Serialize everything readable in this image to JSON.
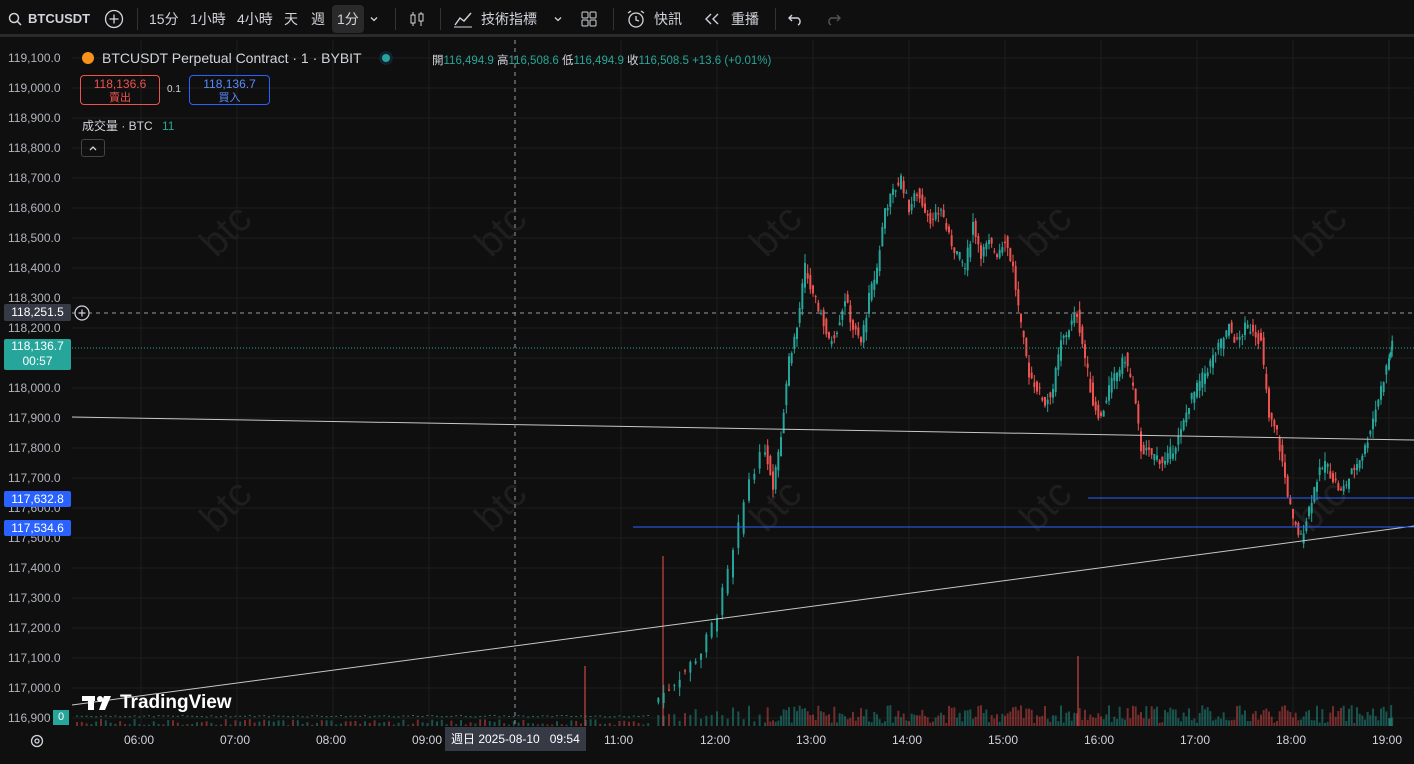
{
  "toolbar": {
    "symbol": "BTCUSDT",
    "timeframes": [
      "15分",
      "1小時",
      "4小時",
      "天",
      "週"
    ],
    "active_timeframe": "1分",
    "indicators_label": "技術指標",
    "alert_label": "快訊",
    "replay_label": "重播"
  },
  "legend": {
    "title": "BTCUSDT Perpetual Contract · 1 · BYBIT",
    "open_label": "開",
    "open": "116,494.9",
    "high_label": "高",
    "high": "116,508.6",
    "low_label": "低",
    "low": "116,494.9",
    "close_label": "收",
    "close": "116,508.5",
    "change": "+13.6 (+0.01%)",
    "sell_price": "118,136.6",
    "sell_label": "賣出",
    "spread": "0.1",
    "buy_price": "118,136.7",
    "buy_label": "買入",
    "volume_label": "成交量 · BTC",
    "volume_value": "11"
  },
  "price_axis": [
    "119,100.0",
    "119,000.0",
    "118,900.0",
    "118,800.0",
    "118,700.0",
    "118,600.0",
    "118,500.0",
    "118,400.0",
    "118,300.0",
    "118,200.0",
    "118,100.0",
    "118,000.0",
    "117,900.0",
    "117,800.0",
    "117,700.0",
    "117,600.0",
    "117,500.0",
    "117,400.0",
    "117,300.0",
    "117,200.0",
    "117,100.0",
    "117,000.0",
    "116,900"
  ],
  "time_axis": [
    "06:00",
    "07:00",
    "08:00",
    "09:00",
    "11:00",
    "12:00",
    "13:00",
    "14:00",
    "15:00",
    "16:00",
    "17:00",
    "18:00",
    "19:00"
  ],
  "crosshair": {
    "price": "118,251.5",
    "time": "週日 2025-08-10   09:54"
  },
  "last_price": {
    "price": "118,136.7",
    "countdown": "00:57"
  },
  "level_tags": [
    "117,632.8",
    "117,534.6"
  ],
  "volume_tag": "0",
  "watermark": "btc",
  "brand": "TradingView",
  "colors": {
    "up": "#26a69a",
    "down": "#ef5350",
    "order_line": "#2962ff",
    "bg": "#0f0f0f"
  },
  "chart_data": {
    "type": "candlestick",
    "ylim": [
      116900,
      119130
    ],
    "x_unit": "minutes since 05:00",
    "series_close": [
      [
        390,
        117000
      ],
      [
        400,
        117060
      ],
      [
        410,
        117120
      ],
      [
        420,
        117250
      ],
      [
        430,
        117450
      ],
      [
        440,
        117700
      ],
      [
        450,
        117800
      ],
      [
        455,
        117680
      ],
      [
        460,
        117850
      ],
      [
        465,
        118100
      ],
      [
        470,
        118200
      ],
      [
        475,
        118400
      ],
      [
        480,
        118300
      ],
      [
        485,
        118250
      ],
      [
        490,
        118150
      ],
      [
        495,
        118200
      ],
      [
        500,
        118300
      ],
      [
        505,
        118200
      ],
      [
        510,
        118150
      ],
      [
        515,
        118300
      ],
      [
        520,
        118400
      ],
      [
        525,
        118600
      ],
      [
        530,
        118650
      ],
      [
        535,
        118700
      ],
      [
        540,
        118600
      ],
      [
        545,
        118650
      ],
      [
        550,
        118600
      ],
      [
        555,
        118550
      ],
      [
        560,
        118600
      ],
      [
        565,
        118500
      ],
      [
        570,
        118450
      ],
      [
        575,
        118400
      ],
      [
        580,
        118550
      ],
      [
        585,
        118450
      ],
      [
        590,
        118480
      ],
      [
        595,
        118450
      ],
      [
        600,
        118500
      ],
      [
        605,
        118400
      ],
      [
        610,
        118200
      ],
      [
        615,
        118050
      ],
      [
        620,
        118000
      ],
      [
        625,
        117950
      ],
      [
        630,
        118000
      ],
      [
        635,
        118150
      ],
      [
        640,
        118200
      ],
      [
        645,
        118250
      ],
      [
        650,
        118100
      ],
      [
        655,
        117950
      ],
      [
        660,
        117900
      ],
      [
        665,
        118000
      ],
      [
        670,
        118050
      ],
      [
        675,
        118100
      ],
      [
        680,
        118000
      ],
      [
        685,
        117800
      ],
      [
        690,
        117780
      ],
      [
        695,
        117770
      ],
      [
        700,
        117750
      ],
      [
        705,
        117800
      ],
      [
        710,
        117850
      ],
      [
        715,
        117950
      ],
      [
        720,
        118000
      ],
      [
        725,
        118050
      ],
      [
        730,
        118100
      ],
      [
        735,
        118150
      ],
      [
        740,
        118200
      ],
      [
        745,
        118150
      ],
      [
        750,
        118200
      ],
      [
        755,
        118200
      ],
      [
        760,
        118150
      ],
      [
        765,
        117900
      ],
      [
        770,
        117850
      ],
      [
        775,
        117700
      ],
      [
        780,
        117550
      ],
      [
        785,
        117500
      ],
      [
        790,
        117600
      ],
      [
        795,
        117700
      ],
      [
        800,
        117750
      ],
      [
        805,
        117700
      ],
      [
        810,
        117650
      ],
      [
        815,
        117700
      ],
      [
        820,
        117750
      ],
      [
        825,
        117800
      ],
      [
        830,
        117900
      ],
      [
        835,
        118000
      ],
      [
        840,
        118100
      ],
      [
        842,
        118140
      ]
    ]
  }
}
